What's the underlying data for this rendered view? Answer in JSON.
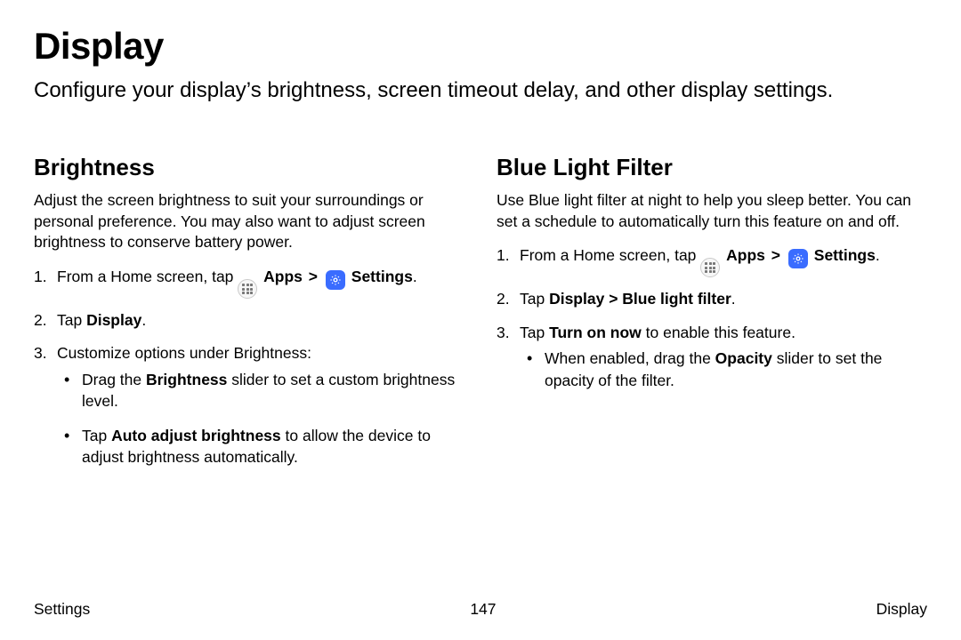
{
  "title": "Display",
  "intro": "Configure your display’s brightness, screen timeout delay, and other display settings.",
  "left": {
    "heading": "Brightness",
    "para": "Adjust the screen brightness to suit your surroundings or personal preference. You may also want to adjust screen brightness to conserve battery power.",
    "step1_pre": "From a Home screen, tap ",
    "apps_label": "Apps",
    "settings_label": "Settings",
    "step2_pre": "Tap ",
    "step2_bold": "Display",
    "step2_post": ".",
    "step3": "Customize options under Brightness:",
    "bullet1_pre": "Drag the ",
    "bullet1_bold": "Brightness",
    "bullet1_post": " slider to set a custom brightness level.",
    "bullet2_pre": "Tap ",
    "bullet2_bold": "Auto adjust brightness",
    "bullet2_post": " to allow the device to adjust brightness automatically."
  },
  "right": {
    "heading": "Blue Light Filter",
    "para": "Use Blue light filter at night to help you sleep better. You can set a schedule to automatically turn this feature on and off.",
    "step1_pre": "From a Home screen, tap ",
    "apps_label": "Apps",
    "settings_label": "Settings",
    "step2_pre": "Tap ",
    "step2_bold": "Display > Blue light filter",
    "step2_post": ".",
    "step3_pre": "Tap ",
    "step3_bold": "Turn on now",
    "step3_post": " to enable this feature.",
    "bullet1_pre": "When enabled, drag the ",
    "bullet1_bold": "Opacity",
    "bullet1_post": " slider to set the opacity of the filter."
  },
  "footer": {
    "left": "Settings",
    "center": "147",
    "right": "Display"
  },
  "glyphs": {
    "chevron": ">"
  }
}
